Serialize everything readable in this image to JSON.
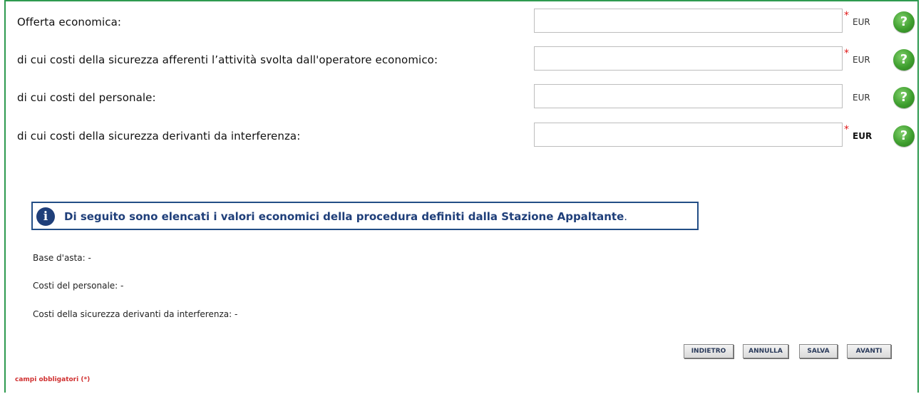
{
  "fields": [
    {
      "label": "Offerta economica:",
      "value": "",
      "required": true,
      "currency": "EUR"
    },
    {
      "label": "di cui costi della sicurezza afferenti l’attività svolta dall'operatore economico:",
      "value": "",
      "required": true,
      "currency": "EUR"
    },
    {
      "label": "di cui costi del personale:",
      "value": "",
      "required": false,
      "currency": "EUR"
    },
    {
      "label": "di cui costi della sicurezza derivanti da interferenza:",
      "value": "",
      "required": true,
      "currency": "EUR"
    }
  ],
  "required_marker": "*",
  "help_symbol": "?",
  "info": {
    "icon_letter": "i",
    "text": "Di seguito sono elencati i valori economici della procedura definiti dalla Stazione Appaltante",
    "tail": "."
  },
  "values": {
    "base_asta": "Base d'asta: -",
    "costi_personale": "Costi del personale: -",
    "costi_sicurezza": "Costi della sicurezza derivanti da interferenza: -"
  },
  "buttons": {
    "back": "INDIETRO",
    "cancel": "ANNULLA",
    "save": "SALVA",
    "next": "AVANTI"
  },
  "footer": {
    "mandatory": "campi obbligatori (*)"
  },
  "colors": {
    "frame": "#2e9a4f",
    "required": "#e01818",
    "info": "#1f3f7a"
  }
}
